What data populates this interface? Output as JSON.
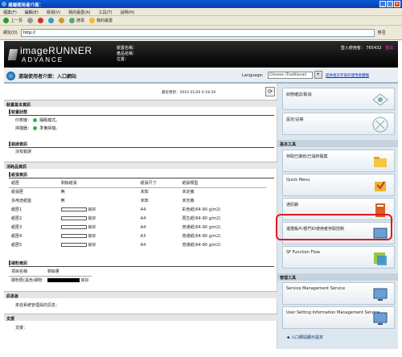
{
  "window": {
    "title": "遠端使用者介面："
  },
  "menu": [
    "檔案(F)",
    "編輯(E)",
    "檢視(V)",
    "我的最愛(A)",
    "工具(T)",
    "說明(H)"
  ],
  "toolbar": {
    "back": "上一頁",
    "search": "搜尋",
    "favorites": "我的最愛"
  },
  "address": {
    "label": "網址(D)",
    "value": "http://",
    "go": "移至"
  },
  "header": {
    "brand_line1": "imageRUNNER",
    "brand_line2": "ADVANCE",
    "device_name_label": "裝置名稱：",
    "product_name_label": "產品名稱：",
    "location_label": "位置：",
    "login_user": "登入使用者：",
    "login_user_value": "765432",
    "logout": "登出"
  },
  "subheader": {
    "title": "遠端使用者介面：入口網站",
    "language_label": "Language:",
    "language_value": "Chinese (Traditional)",
    "access_link": "提供易於存取的使用者體驗"
  },
  "main": {
    "updated": "最近更新：2010 01/20 0:18:39",
    "device_basic": "裝置基本資訊",
    "device_status": "裝置狀態",
    "printer_label": "印表機：",
    "printer_status": "睡眠模式。",
    "scanner_label": "掃描器：",
    "scanner_status": "準備掃描。",
    "error_info": "錯誤資訊",
    "no_error": "沒有錯誤",
    "consumables": "消耗品資訊",
    "paper_info": "紙張資訊",
    "paper_headers": [
      "紙匣",
      "剩餘紙張",
      "紙張尺寸",
      "紙張類型"
    ],
    "paper_rows": [
      {
        "tray": "紙張匣",
        "level": "無",
        "bar": false,
        "size": "未知",
        "type": "未定義"
      },
      {
        "tray": "多用途紙盤",
        "level": "無",
        "bar": false,
        "size": "未知",
        "type": "未定義"
      },
      {
        "tray": "紙匣1",
        "level": "良好",
        "bar": true,
        "size": "A4",
        "type": "彩色紙(64-90 g/m2)"
      },
      {
        "tray": "紙匣2",
        "level": "良好",
        "bar": true,
        "size": "A4",
        "type": "再生紙(64-90 g/m2)"
      },
      {
        "tray": "紙匣3",
        "level": "良好",
        "bar": true,
        "size": "A4",
        "type": "普通紙(64-90 g/m2)"
      },
      {
        "tray": "紙匣4",
        "level": "良好",
        "bar": true,
        "size": "A3",
        "type": "普通紙(64-90 g/m2)"
      },
      {
        "tray": "紙匣5",
        "level": "良好",
        "bar": true,
        "size": "A4",
        "type": "普通紙(64-90 g/m2)"
      }
    ],
    "toner_info": "碳粉資訊",
    "toner_header_name": "項目名稱",
    "toner_header_level": "剩餘量",
    "toner_name": "碳粉匣(黑色)碳粉",
    "toner_level": "良好",
    "messages": "訊息板",
    "messages_text": "來自系統管理員的訊息：",
    "support": "支援",
    "support_text": "支援："
  },
  "right": {
    "status_monitor": "狀態確認/取消",
    "settings": "設定/註冊",
    "basic_tools": "基本工具",
    "access_files": "存取已接收/已儲存檔案",
    "quick_menu": "Quick Menu",
    "address_book": "通訊錄",
    "dept_id": "進階帳戶/部門ID使用者存取控制",
    "sf_flow": "SF Function Flow",
    "mgmt_tools": "管理工具",
    "service_mgmt": "Service Management Service",
    "user_setting_mgmt": "User Setting Information Management Service",
    "portal_settings": "入口網站顯示設定"
  }
}
